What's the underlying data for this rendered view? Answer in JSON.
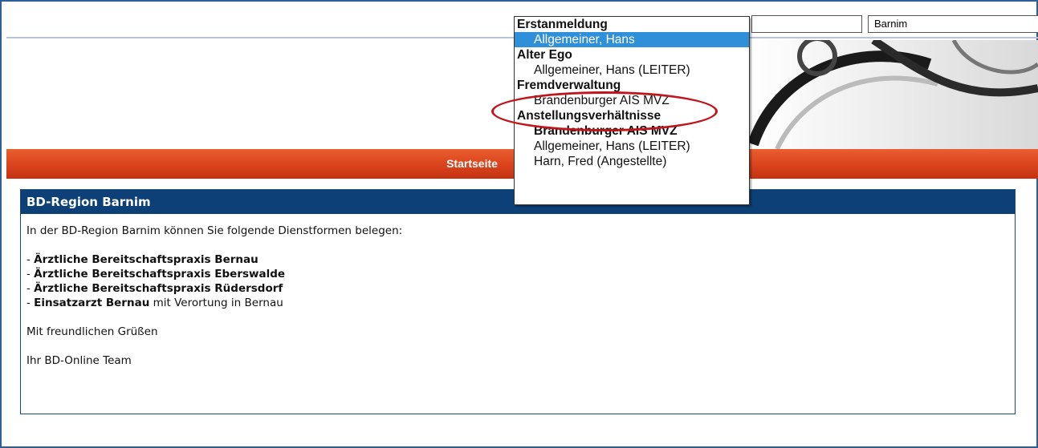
{
  "header": {
    "region_field_value": "Barnim"
  },
  "nav": {
    "home_label": "Startseite"
  },
  "dropdown": {
    "groups": [
      {
        "label": "Erstanmeldung",
        "options": [
          {
            "label": "Allgemeiner, Hans"
          }
        ]
      },
      {
        "label": "Alter Ego",
        "options": [
          {
            "label": "Allgemeiner, Hans (LEITER)"
          }
        ]
      },
      {
        "label": "Fremdverwaltung",
        "options": [
          {
            "label": "Brandenburger AIS MVZ"
          }
        ]
      },
      {
        "label": "Anstellungsverhältnisse",
        "options": [
          {
            "label": "Brandenburger AIS MVZ"
          },
          {
            "label": "Allgemeiner, Hans (LEITER)"
          },
          {
            "label": "Harn, Fred (Angestellte)"
          }
        ]
      }
    ]
  },
  "content": {
    "title": "BD-Region Barnim",
    "intro": "In der BD-Region Barnim können Sie folgende Dienstformen belegen:",
    "items": [
      {
        "prefix": "- ",
        "bold": "Ärztliche Bereitschaftspraxis Bernau",
        "rest": ""
      },
      {
        "prefix": "- ",
        "bold": "Ärztliche Bereitschaftspraxis Eberswalde",
        "rest": ""
      },
      {
        "prefix": "- ",
        "bold": "Ärztliche Bereitschaftspraxis Rüdersdorf",
        "rest": ""
      },
      {
        "prefix": "- ",
        "bold": "Einsatzarzt Bernau",
        "rest": " mit Verortung in Bernau"
      }
    ],
    "greeting": "Mit freundlichen Grüßen",
    "signature": "Ihr BD-Online Team"
  },
  "colors": {
    "nav_bar": "#d9421c",
    "box_header": "#0e4078",
    "selected_option": "#2f8fd8",
    "annotation_oval": "#c0151b"
  }
}
